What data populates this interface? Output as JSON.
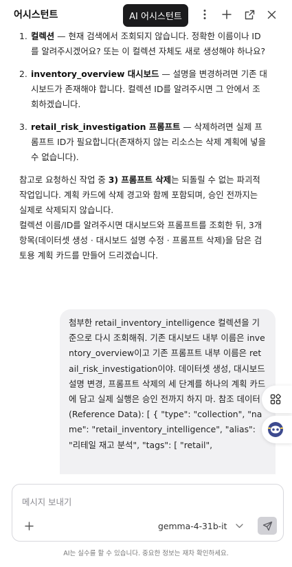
{
  "header": {
    "title": "어시스턴트",
    "tooltip": "AI 어시스턴트",
    "icons": [
      "more-icon",
      "plus-icon",
      "popout-icon",
      "close-icon"
    ]
  },
  "assistant_message": {
    "items": [
      {
        "num": "1.",
        "bold": "컬렉션",
        "text": " — 현재 검색에서 조회되지 않습니다. 정확한 이름이나 ID를 알려주시겠어요? 또는 이 컬렉션 자체도 새로 생성해야 하나요?"
      },
      {
        "num": "2.",
        "bold": "inventory_overview 대시보드",
        "text": " — 설명을 변경하려면 기존 대시보드가 존재해야 합니다. 컬렉션 ID를 알려주시면 그 안에서 조회하겠습니다."
      },
      {
        "num": "3.",
        "bold": "retail_risk_investigation 프롬프트",
        "text": " — 삭제하려면 실제 프롬프트 ID가 필요합니다(존재하지 않는 리소스는 삭제 계획에 넣을 수 없습니다)."
      }
    ],
    "para1_prefix": "참고로 요청하신 작업 중 ",
    "para1_bold": "3) 프롬프트 삭제",
    "para1_suffix": "는 되돌릴 수 없는 파괴적 작업입니다. 계획 카드에 삭제 경고와 함께 포함되며, 승인 전까지는 실제로 삭제되지 않습니다.",
    "para2": "컬렉션 이름/ID를 알려주시면 대시보드와 프롬프트를 조회한 뒤, 3개 항목(데이터셋 생성 · 대시보드 설명 수정 · 프롬프트 삭제)을 담은 검토용 계획 카드를 만들어 드리겠습니다."
  },
  "user_message": {
    "text": "첨부한 retail_inventory_intelligence 컬렉션을 기준으로 다시 조회해줘. 기존 대시보드 내부 이름은 inventory_overview이고 기존 프롬프트 내부 이름은 retail_risk_investigation이야. 데이터셋 생성, 대시보드 설명 변경, 프롬프트 삭제의 세 단계를 하나의 계획 카드에 담고 실제 실행은 승인 전까지 하지 마. 참조 데이터 (Reference Data): [ { \"type\": \"collection\", \"name\": \"retail_inventory_intelligence\", \"alias\": \"리테일 재고 분석\", \"tags\": [ \"retail\","
  },
  "floating": {
    "apps_icon": "apps-grid-icon",
    "bot_icon": "assistant-bot-icon"
  },
  "composer": {
    "placeholder": "메시지 보내기",
    "model": "gemma-4-31b-it",
    "send_icon": "send-icon"
  },
  "footer": {
    "disclaimer": "AI는 실수를 할 수 있습니다. 중요한 정보는 재차 확인하세요."
  },
  "colors": {
    "tooltip_bg": "#1b1b1d",
    "bubble_bg": "#f1f1f3",
    "send_bg": "#d1d1d6",
    "bot_icon": "#3d4a8f"
  }
}
